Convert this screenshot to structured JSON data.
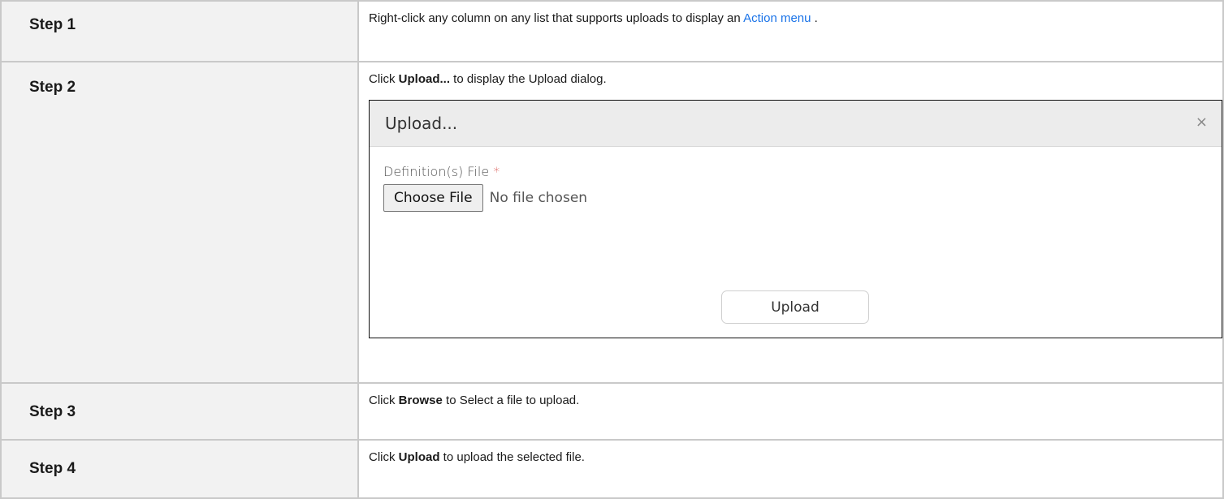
{
  "steps": [
    {
      "label": "Step 1",
      "text_before": "Right-click any column on any list that supports uploads to display an ",
      "link": "Action menu",
      "text_after": " ."
    },
    {
      "label": "Step 2",
      "text_before": "Click ",
      "bold": "Upload...",
      "text_after": " to display the Upload dialog."
    },
    {
      "label": "Step 3",
      "text_before": "Click ",
      "bold": "Browse",
      "text_after": " to Select a file to upload."
    },
    {
      "label": "Step 4",
      "text_before": "Click ",
      "bold": "Upload",
      "text_after": " to upload the selected file."
    }
  ],
  "dialog": {
    "title": "Upload...",
    "close": "×",
    "field_label": "Definition(s) File",
    "required_marker": "*",
    "choose_file_label": "Choose File",
    "no_file_text": "No file chosen",
    "upload_label": "Upload"
  },
  "colors": {
    "link": "#1a73e8",
    "label_bg": "#f2f2f2",
    "required": "#d9534f"
  }
}
